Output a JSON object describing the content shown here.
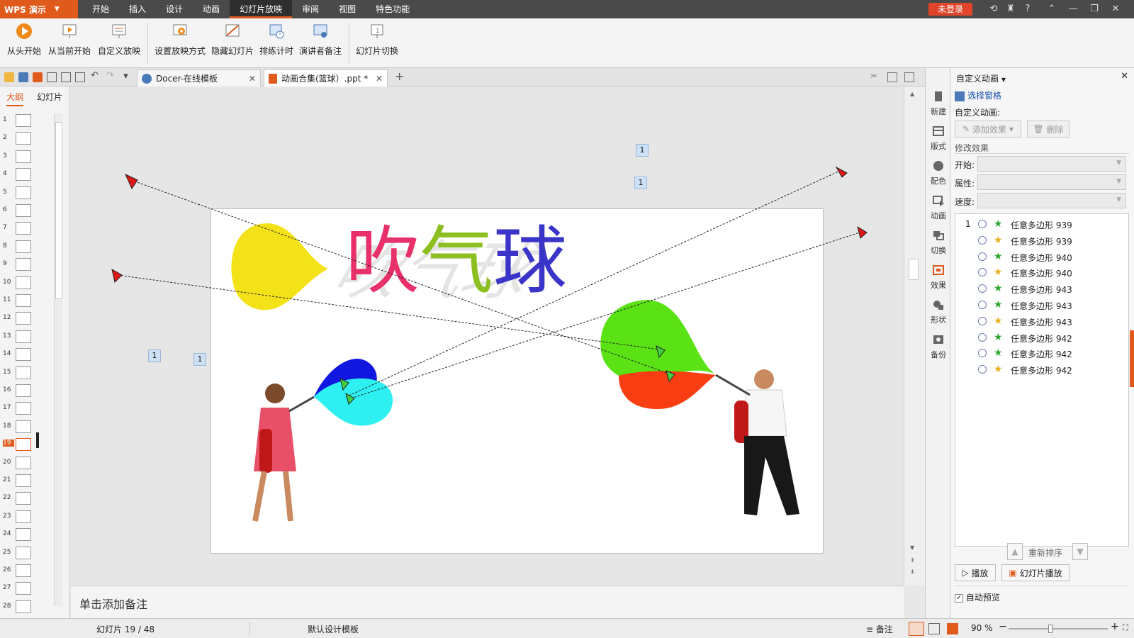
{
  "app": {
    "name": "WPS 演示",
    "login": "未登录"
  },
  "menu": [
    "开始",
    "插入",
    "设计",
    "动画",
    "幻灯片放映",
    "审阅",
    "视图",
    "特色功能"
  ],
  "ribbon": {
    "buttons": [
      "从头开始",
      "从当前开始",
      "自定义放映",
      "设置放映方式",
      "隐藏幻灯片",
      "排练计时",
      "演讲者备注",
      "幻灯片切换"
    ]
  },
  "tabs": [
    {
      "label": "Docer-在线模板"
    },
    {
      "label": "动画合集(篮球）.ppt *"
    }
  ],
  "left_panel": {
    "tabs": [
      "大纲",
      "幻灯片"
    ],
    "slide_numbers": [
      "1",
      "2",
      "3",
      "4",
      "5",
      "6",
      "7",
      "8",
      "9",
      "10",
      "11",
      "12",
      "13",
      "14",
      "15",
      "16",
      "17",
      "18",
      "19",
      "20",
      "21",
      "22",
      "23",
      "24",
      "25",
      "26",
      "27",
      "28"
    ],
    "selected": "19"
  },
  "slide": {
    "title_chars": [
      {
        "ch": "吹",
        "color": "#e8306a"
      },
      {
        "ch": "气",
        "color": "#8cc020"
      },
      {
        "ch": "球",
        "color": "#3a34c8"
      }
    ],
    "anim_tags": [
      "1",
      "1",
      "1",
      "1"
    ]
  },
  "notes": {
    "placeholder": "单击添加备注"
  },
  "sidebar": [
    "新建",
    "版式",
    "配色",
    "动画",
    "切换",
    "效果",
    "形状",
    "备份"
  ],
  "right_pane": {
    "title": "自定义动画",
    "selection_pane": "选择窗格",
    "section": "自定义动画:",
    "add_effect": "添加效果",
    "delete": "删除",
    "modify": "修改效果",
    "start_label": "开始:",
    "property_label": "属性:",
    "speed_label": "速度:",
    "animations": [
      {
        "num": "1",
        "name": "任意多边形 939",
        "star": "#2aa82a"
      },
      {
        "num": "",
        "name": "任意多边形 939",
        "star": "#e8b020"
      },
      {
        "num": "",
        "name": "任意多边形 940",
        "star": "#2aa82a"
      },
      {
        "num": "",
        "name": "任意多边形 940",
        "star": "#e8b020"
      },
      {
        "num": "",
        "name": "任意多边形 943",
        "star": "#2aa82a"
      },
      {
        "num": "",
        "name": "任意多边形 943",
        "star": "#2aa82a"
      },
      {
        "num": "",
        "name": "任意多边形 943",
        "star": "#e8b020"
      },
      {
        "num": "",
        "name": "任意多边形 942",
        "star": "#2aa82a"
      },
      {
        "num": "",
        "name": "任意多边形 942",
        "star": "#2aa82a"
      },
      {
        "num": "",
        "name": "任意多边形 942",
        "star": "#e8b020"
      }
    ],
    "reorder": "重新排序",
    "play": "播放",
    "slideshow": "幻灯片播放",
    "auto_preview": "自动预览"
  },
  "status": {
    "slide_info": "幻灯片 19 / 48",
    "template": "默认设计模板",
    "notes": "备注",
    "zoom": "90 %",
    "zoom_level_fraction": 0.42
  },
  "colors": {
    "accent": "#e05a1c",
    "menubar": "#4a4a4a"
  }
}
